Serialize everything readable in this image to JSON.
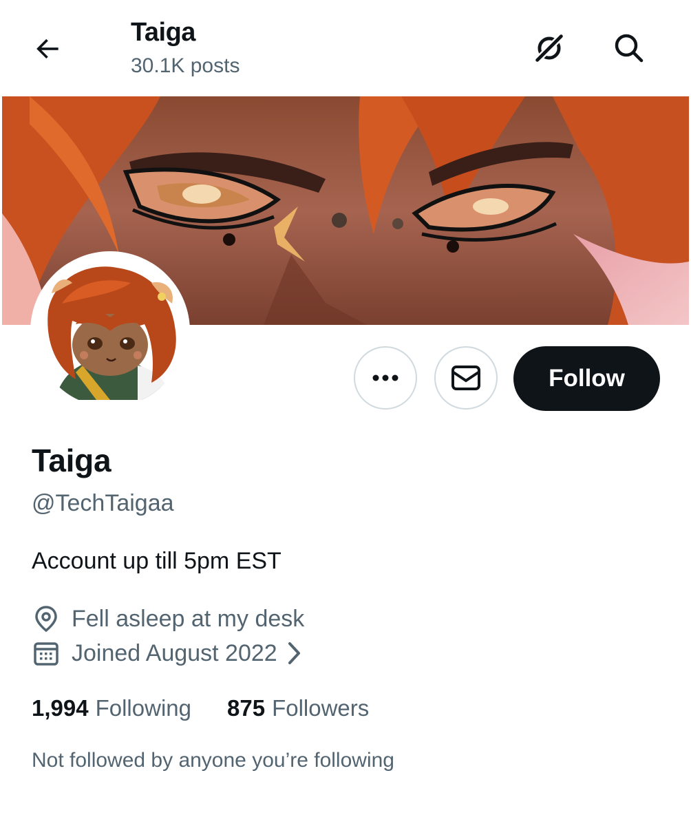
{
  "header": {
    "title": "Taiga",
    "posts_count": "30.1K posts",
    "icons": [
      "back-arrow-icon",
      "grok-icon",
      "search-icon"
    ]
  },
  "banner": {
    "image": "anime-eyes-closeup"
  },
  "avatar": {
    "image": "chibi-character-orange-hair"
  },
  "actions": {
    "more_icon": "more-dots-icon",
    "message_icon": "envelope-icon",
    "follow_label": "Follow"
  },
  "profile": {
    "name": "Taiga",
    "handle": "@TechTaigaa",
    "bio": "Account up till 5pm EST",
    "location": "Fell asleep at my desk",
    "joined": "Joined August 2022",
    "following_count": "1,994",
    "following_label": "Following",
    "followers_count": "875",
    "followers_label": "Followers",
    "followed_note": "Not followed by anyone you’re following"
  },
  "colors": {
    "text": "#0f1419",
    "muted": "#536471",
    "border": "#cfd9de",
    "button": "#0f1419"
  }
}
